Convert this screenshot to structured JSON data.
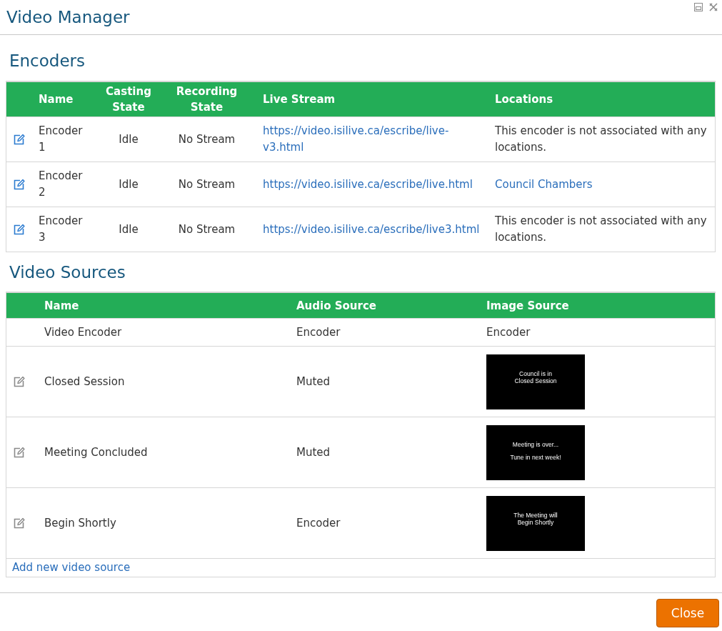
{
  "window": {
    "title": "Video Manager"
  },
  "encoders": {
    "heading": "Encoders",
    "columns": [
      "Name",
      "Casting State",
      "Recording State",
      "Live Stream",
      "Locations"
    ],
    "rows": [
      {
        "name": "Encoder 1",
        "casting_state": "Idle",
        "recording_state": "No Stream",
        "live_stream": "https://video.isilive.ca/escribe/live-v3.html",
        "location": {
          "kind": "text",
          "text": "This encoder is not associated with any locations."
        }
      },
      {
        "name": "Encoder 2",
        "casting_state": "Idle",
        "recording_state": "No Stream",
        "live_stream": "https://video.isilive.ca/escribe/live.html",
        "location": {
          "kind": "link",
          "text": "Council Chambers"
        }
      },
      {
        "name": "Encoder 3",
        "casting_state": "Idle",
        "recording_state": "No Stream",
        "live_stream": "https://video.isilive.ca/escribe/live3.html",
        "location": {
          "kind": "text",
          "text": "This encoder is not associated with any locations."
        }
      }
    ]
  },
  "video_sources": {
    "heading": "Video Sources",
    "columns": [
      "Name",
      "Audio Source",
      "Image Source"
    ],
    "rows": [
      {
        "name": "Video Encoder",
        "editable": false,
        "audio_source": "Encoder",
        "image_source": {
          "kind": "text",
          "text": "Encoder"
        }
      },
      {
        "name": "Closed Session",
        "editable": true,
        "audio_source": "Muted",
        "image_source": {
          "kind": "slide",
          "paragraphs": [
            "Council is in\nClosed Session"
          ]
        }
      },
      {
        "name": "Meeting Concluded",
        "editable": true,
        "audio_source": "Muted",
        "image_source": {
          "kind": "slide",
          "paragraphs": [
            "Meeting is over...",
            "Tune in next week!"
          ]
        }
      },
      {
        "name": "Begin Shortly",
        "editable": true,
        "audio_source": "Encoder",
        "image_source": {
          "kind": "slide",
          "paragraphs": [
            "The Meeting will\nBegin Shortly"
          ]
        }
      }
    ],
    "add_link": "Add new video source"
  },
  "footer": {
    "close_button": "Close"
  }
}
